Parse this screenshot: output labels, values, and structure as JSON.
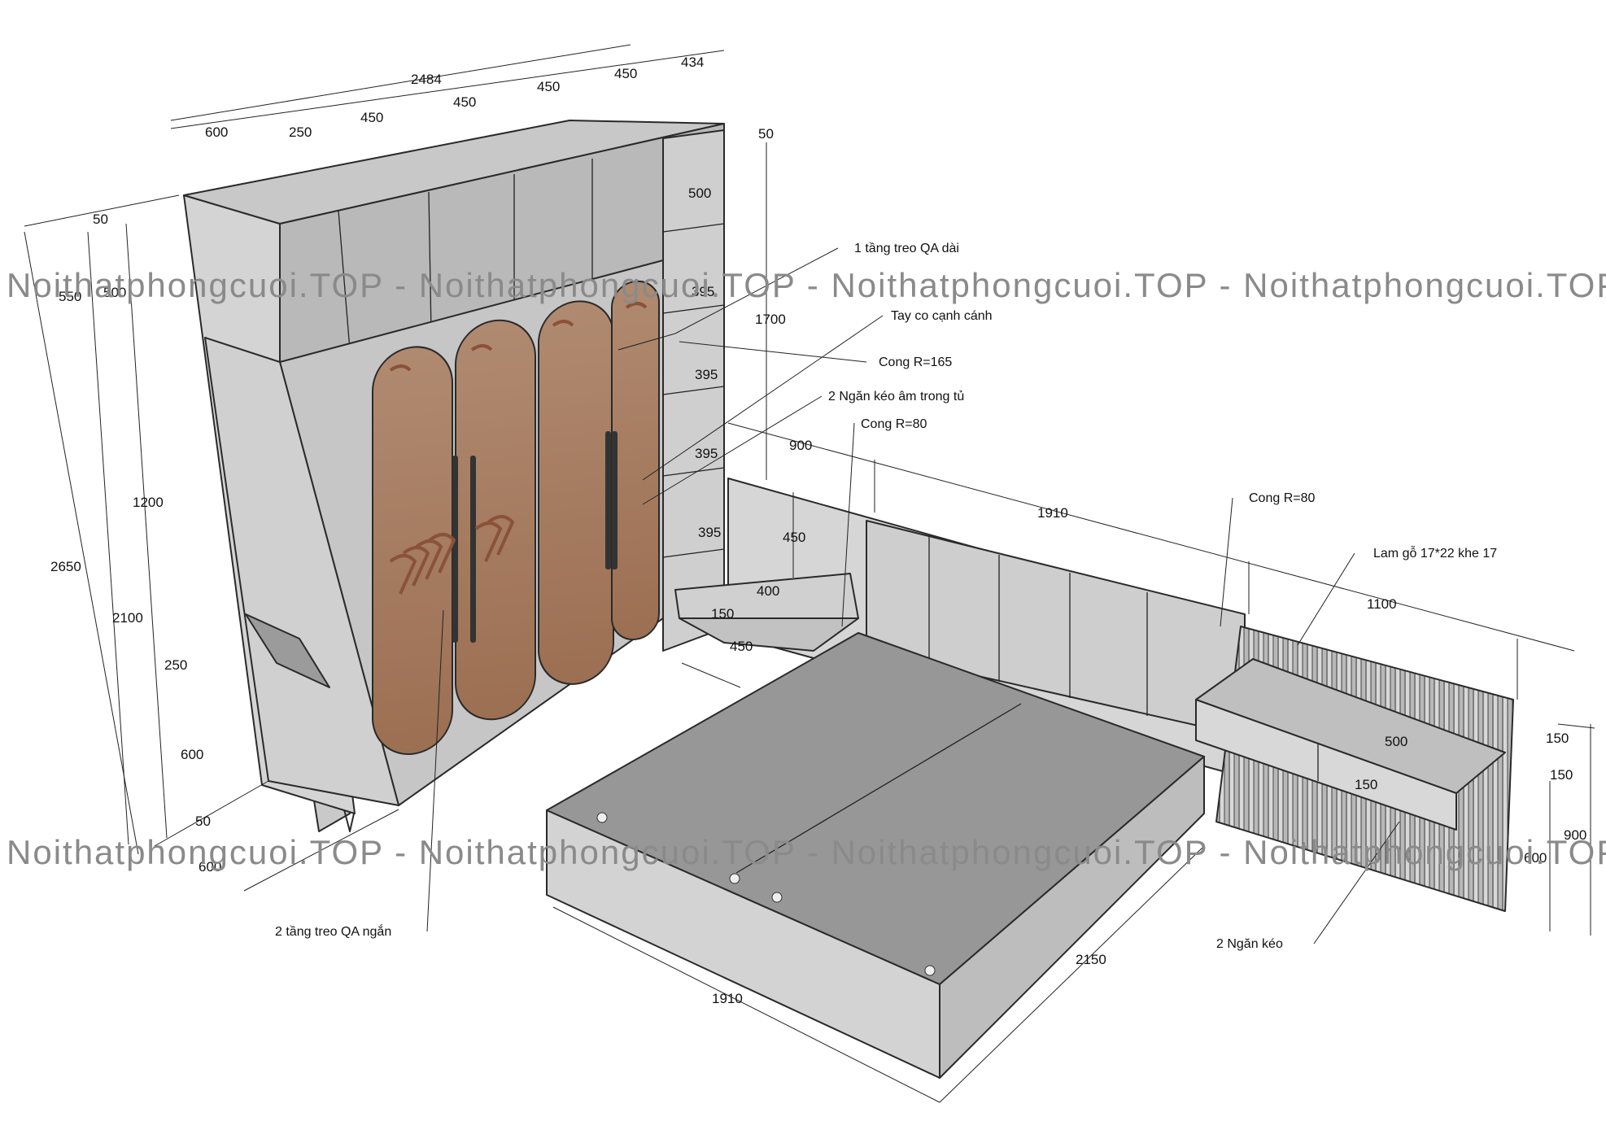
{
  "watermark": {
    "text": "Noithatphongcuoi.TOP - Noithatphongcuoi.TOP - Noithatphongcuoi.TOP - Noithatphongcuoi.TOP"
  },
  "wardrobe": {
    "width_total": "2484",
    "top_widths": [
      "600",
      "250",
      "450",
      "450",
      "450",
      "450",
      "434"
    ],
    "side_50_top": "50",
    "side_50_right": "50",
    "left_heights": [
      "50",
      "550",
      "500"
    ],
    "height_total": "2650",
    "height_2100": "2100",
    "height_1200": "1200",
    "height_250": "250",
    "height_600": "600",
    "base_50": "50",
    "depth_600": "600",
    "shelf_500": "500",
    "shelf_395": [
      "395",
      "395",
      "395",
      "395"
    ],
    "height_1700": "1700"
  },
  "bed": {
    "side_900": "900",
    "head_1910": "1910",
    "side_1100": "1100",
    "bench_450_h": "450",
    "bench_400": "400",
    "bench_150": "150",
    "bench_450_d": "450",
    "length_2150": "2150",
    "width_1910": "1910"
  },
  "nightstand": {
    "d500": "500",
    "d150_top": "150",
    "d150_mid": "150",
    "d150_inner": "150",
    "h900": "900",
    "h600": "600"
  },
  "notes": {
    "long_hang": "1 tầng treo QA dài",
    "edge_handle": "Tay co cạnh cánh",
    "curve_165": "Cong R=165",
    "hidden_drawers": "2 Ngăn kéo âm trong tủ",
    "curve_80_a": "Cong R=80",
    "curve_80_b": "Cong R=80",
    "slats": "Lam gỗ 17*22 khe 17",
    "short_hang": "2 tầng treo QA ngắn",
    "drawers": "2 Ngăn kéo"
  },
  "colors": {
    "panel_light": "#d9d9d9",
    "panel_mid": "#b4b4b4",
    "panel_dark": "#8f8f8f",
    "glass_brown": "#a87d62",
    "hanger_brown": "#8a5238"
  }
}
